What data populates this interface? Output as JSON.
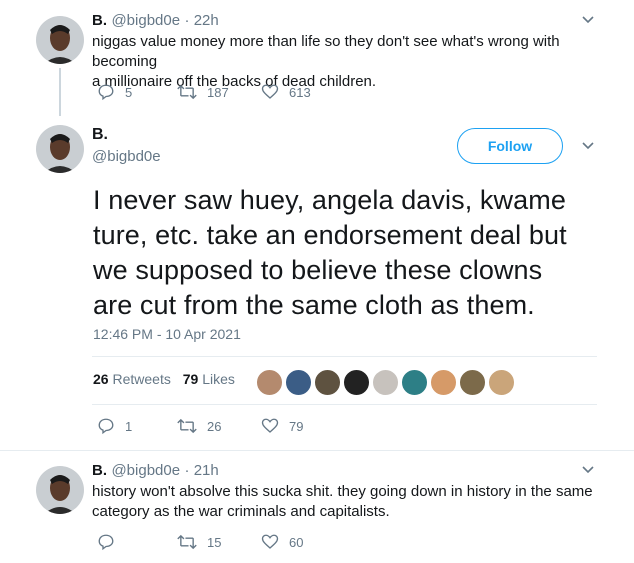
{
  "tweets": [
    {
      "name": "B.",
      "handle": "@bigbd0e",
      "time": "22h",
      "text_line1": "niggas value money more than life so they don't see what's wrong with becoming",
      "text_line2": "a millionaire off the backs of dead children.",
      "replies": "5",
      "retweets": "187",
      "likes": "613"
    },
    {
      "name": "B.",
      "handle": "@bigbd0e",
      "time": "21h",
      "text_line1": "history won't absolve this sucka shit. they going down in history in the same",
      "text_line2": "category as the war criminals and capitalists.",
      "replies": "",
      "retweets": "15",
      "likes": "60"
    }
  ],
  "focus": {
    "name": "B.",
    "handle": "@bigbd0e",
    "follow_label": "Follow",
    "lines": [
      "I never saw huey, angela davis, kwame",
      "ture, etc. take an endorsement deal but",
      "we supposed to believe these clowns",
      "are cut from the same cloth as them."
    ],
    "timestamp": "12:46 PM - 10 Apr 2021",
    "retweet_count": "26",
    "retweet_label": "Retweets",
    "like_count": "79",
    "like_label": "Likes",
    "replies": "1",
    "retweets": "26",
    "likes": "79"
  },
  "colors": {
    "accent": "#1da1f2",
    "muted": "#657786",
    "line": "#ccd6dd"
  },
  "icons": [
    "reply-icon",
    "retweet-icon",
    "like-icon",
    "caret-down-icon"
  ]
}
